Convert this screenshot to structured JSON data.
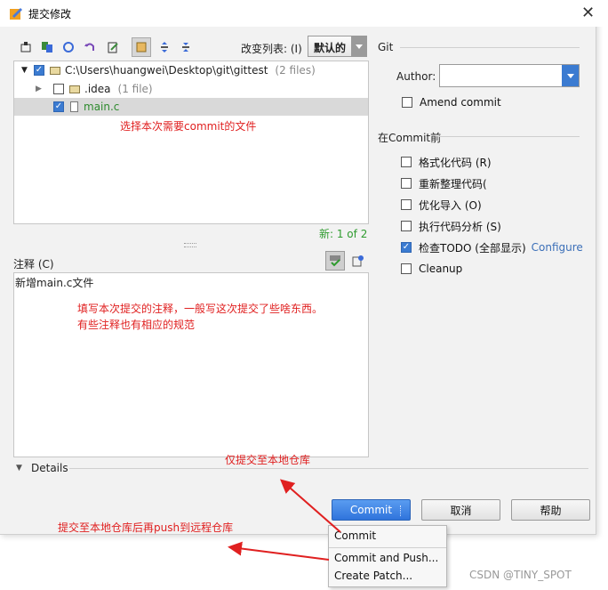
{
  "window": {
    "title": "提交修改",
    "close_glyph": "✕"
  },
  "toolbar": {
    "icons": [
      "refresh-icon",
      "diff-icon",
      "revert-icon",
      "undo-icon",
      "edit-icon",
      "group-icon",
      "expand-all-icon",
      "collapse-all-icon"
    ],
    "changelist_label": "改变列表: (I)",
    "changelist_value": "默认的"
  },
  "tree": {
    "root": {
      "label": "C:\\Users\\huangwei\\Desktop\\git\\gittest",
      "count": "(2 files)"
    },
    "items": [
      {
        "label": ".idea",
        "count": "(1 file)",
        "checked": false
      },
      {
        "label": "main.c",
        "checked": true
      }
    ],
    "status": "新: 1 of 2"
  },
  "comment": {
    "label": "注释 (C)",
    "value": "新增main.c文件"
  },
  "details_label": "Details",
  "git": {
    "section_title": "Git",
    "author_label": "Author:",
    "author_value": "",
    "amend_label": "Amend commit"
  },
  "before_commit": {
    "section_title": "在Commit前",
    "options": [
      {
        "label": "格式化代码 (R)",
        "checked": false
      },
      {
        "label": "重新整理代码(",
        "checked": false
      },
      {
        "label": "优化导入 (O)",
        "checked": false
      },
      {
        "label": "执行代码分析 (S)",
        "checked": false
      },
      {
        "label": "检查TODO (全部显示)",
        "checked": true
      },
      {
        "label": "Cleanup",
        "checked": false
      }
    ],
    "configure_link": "Configure"
  },
  "buttons": {
    "commit": "Commit",
    "cancel": "取消",
    "help": "帮助"
  },
  "commit_menu": {
    "items": [
      "Commit",
      "Commit and Push...",
      "Create Patch..."
    ]
  },
  "annotations": {
    "select_files": "选择本次需要commit的文件",
    "comment_note_line1": "填写本次提交的注释，一般写这次提交了些啥东西。",
    "comment_note_line2": "有些注释也有相应的规范",
    "local_only": "仅提交至本地仓库",
    "commit_push": "提交至本地仓库后再push到远程仓库"
  },
  "watermark": "CSDN @TINY_SPOT",
  "colors": {
    "accent": "#2f74dc",
    "annotation": "#e02020",
    "tree_file_green": "#2e8b2e",
    "status_green": "#2e9b2e"
  }
}
